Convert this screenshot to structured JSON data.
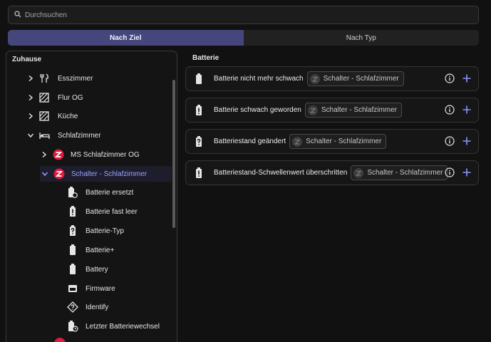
{
  "search": {
    "placeholder": "Durchsuchen",
    "value": ""
  },
  "tabs": [
    {
      "label": "Nach Ziel",
      "active": true
    },
    {
      "label": "Nach Typ",
      "active": false
    }
  ],
  "left_panel": {
    "header": "Zuhause",
    "items": [
      {
        "label": "Esszimmer",
        "icon": "fork-knife-icon"
      },
      {
        "label": "Flur OG",
        "icon": "area-icon"
      },
      {
        "label": "Küche",
        "icon": "area-icon"
      },
      {
        "label": "Schlafzimmer",
        "icon": "bed-icon"
      },
      {
        "label": "MS Schlafzimmer OG",
        "icon": "zwave-icon"
      },
      {
        "label": "Schalter - Schlafzimmer",
        "icon": "zwave-icon",
        "selected": true
      },
      {
        "label": "Batterie ersetzt",
        "icon": "battery-sync-icon"
      },
      {
        "label": "Batterie fast leer",
        "icon": "battery-alert-icon"
      },
      {
        "label": "Batterie-Typ",
        "icon": "battery-unknown-icon"
      },
      {
        "label": "Batterie+",
        "icon": "battery-icon"
      },
      {
        "label": "Battery",
        "icon": "battery-icon"
      },
      {
        "label": "Firmware",
        "icon": "firmware-icon"
      },
      {
        "label": "Identify",
        "icon": "help-rhombus-icon"
      },
      {
        "label": "Letzter Batteriewechsel",
        "icon": "battery-clock-icon"
      }
    ]
  },
  "right_panel": {
    "header": "Batterie",
    "cards": [
      {
        "label": "Batterie nicht mehr schwach",
        "chip": "Schalter - Schlafzimmer",
        "icon": "battery-icon"
      },
      {
        "label": "Batterie schwach geworden",
        "chip": "Schalter - Schlafzimmer",
        "icon": "battery-alert-icon"
      },
      {
        "label": "Batteriestand geändert",
        "chip": "Schalter - Schlafzimmer",
        "icon": "battery-unknown-icon"
      },
      {
        "label": "Batteriestand-Schwellenwert überschritten",
        "chip": "Schalter - Schlafzimmer",
        "icon": "battery-alert-icon"
      }
    ]
  },
  "colors": {
    "accent": "#45467c",
    "selected_text": "#9ea4ff",
    "add": "#8f93ff",
    "zwave": "#e0193f"
  }
}
